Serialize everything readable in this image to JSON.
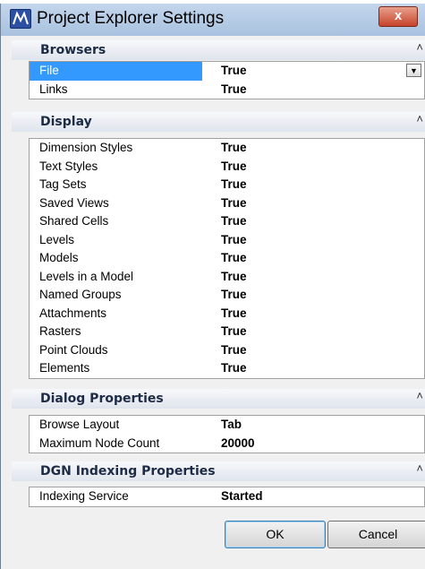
{
  "window": {
    "title": "Project Explorer Settings",
    "close_glyph": "x"
  },
  "sections": {
    "browsers": {
      "title": "Browsers",
      "rows": [
        {
          "label": "File",
          "value": "True"
        },
        {
          "label": "Links",
          "value": "True"
        }
      ]
    },
    "display": {
      "title": "Display",
      "rows": [
        {
          "label": "Dimension Styles",
          "value": "True"
        },
        {
          "label": "Text Styles",
          "value": "True"
        },
        {
          "label": "Tag Sets",
          "value": "True"
        },
        {
          "label": "Saved Views",
          "value": "True"
        },
        {
          "label": "Shared Cells",
          "value": "True"
        },
        {
          "label": "Levels",
          "value": "True"
        },
        {
          "label": "Models",
          "value": "True"
        },
        {
          "label": "Levels in a Model",
          "value": "True"
        },
        {
          "label": "Named Groups",
          "value": "True"
        },
        {
          "label": "Attachments",
          "value": "True"
        },
        {
          "label": "Rasters",
          "value": "True"
        },
        {
          "label": "Point Clouds",
          "value": "True"
        },
        {
          "label": "Elements",
          "value": "True"
        }
      ]
    },
    "dialog": {
      "title": "Dialog Properties",
      "rows": [
        {
          "label": "Browse Layout",
          "value": "Tab"
        },
        {
          "label": "Maximum Node Count",
          "value": "20000"
        }
      ]
    },
    "indexing": {
      "title": "DGN Indexing Properties",
      "rows": [
        {
          "label": "Indexing Service",
          "value": "Started"
        }
      ]
    }
  },
  "buttons": {
    "ok": "OK",
    "cancel": "Cancel"
  },
  "colors": {
    "selection": "#3399ff",
    "titlebar": "#b4cbe5",
    "close": "#c7432c"
  }
}
